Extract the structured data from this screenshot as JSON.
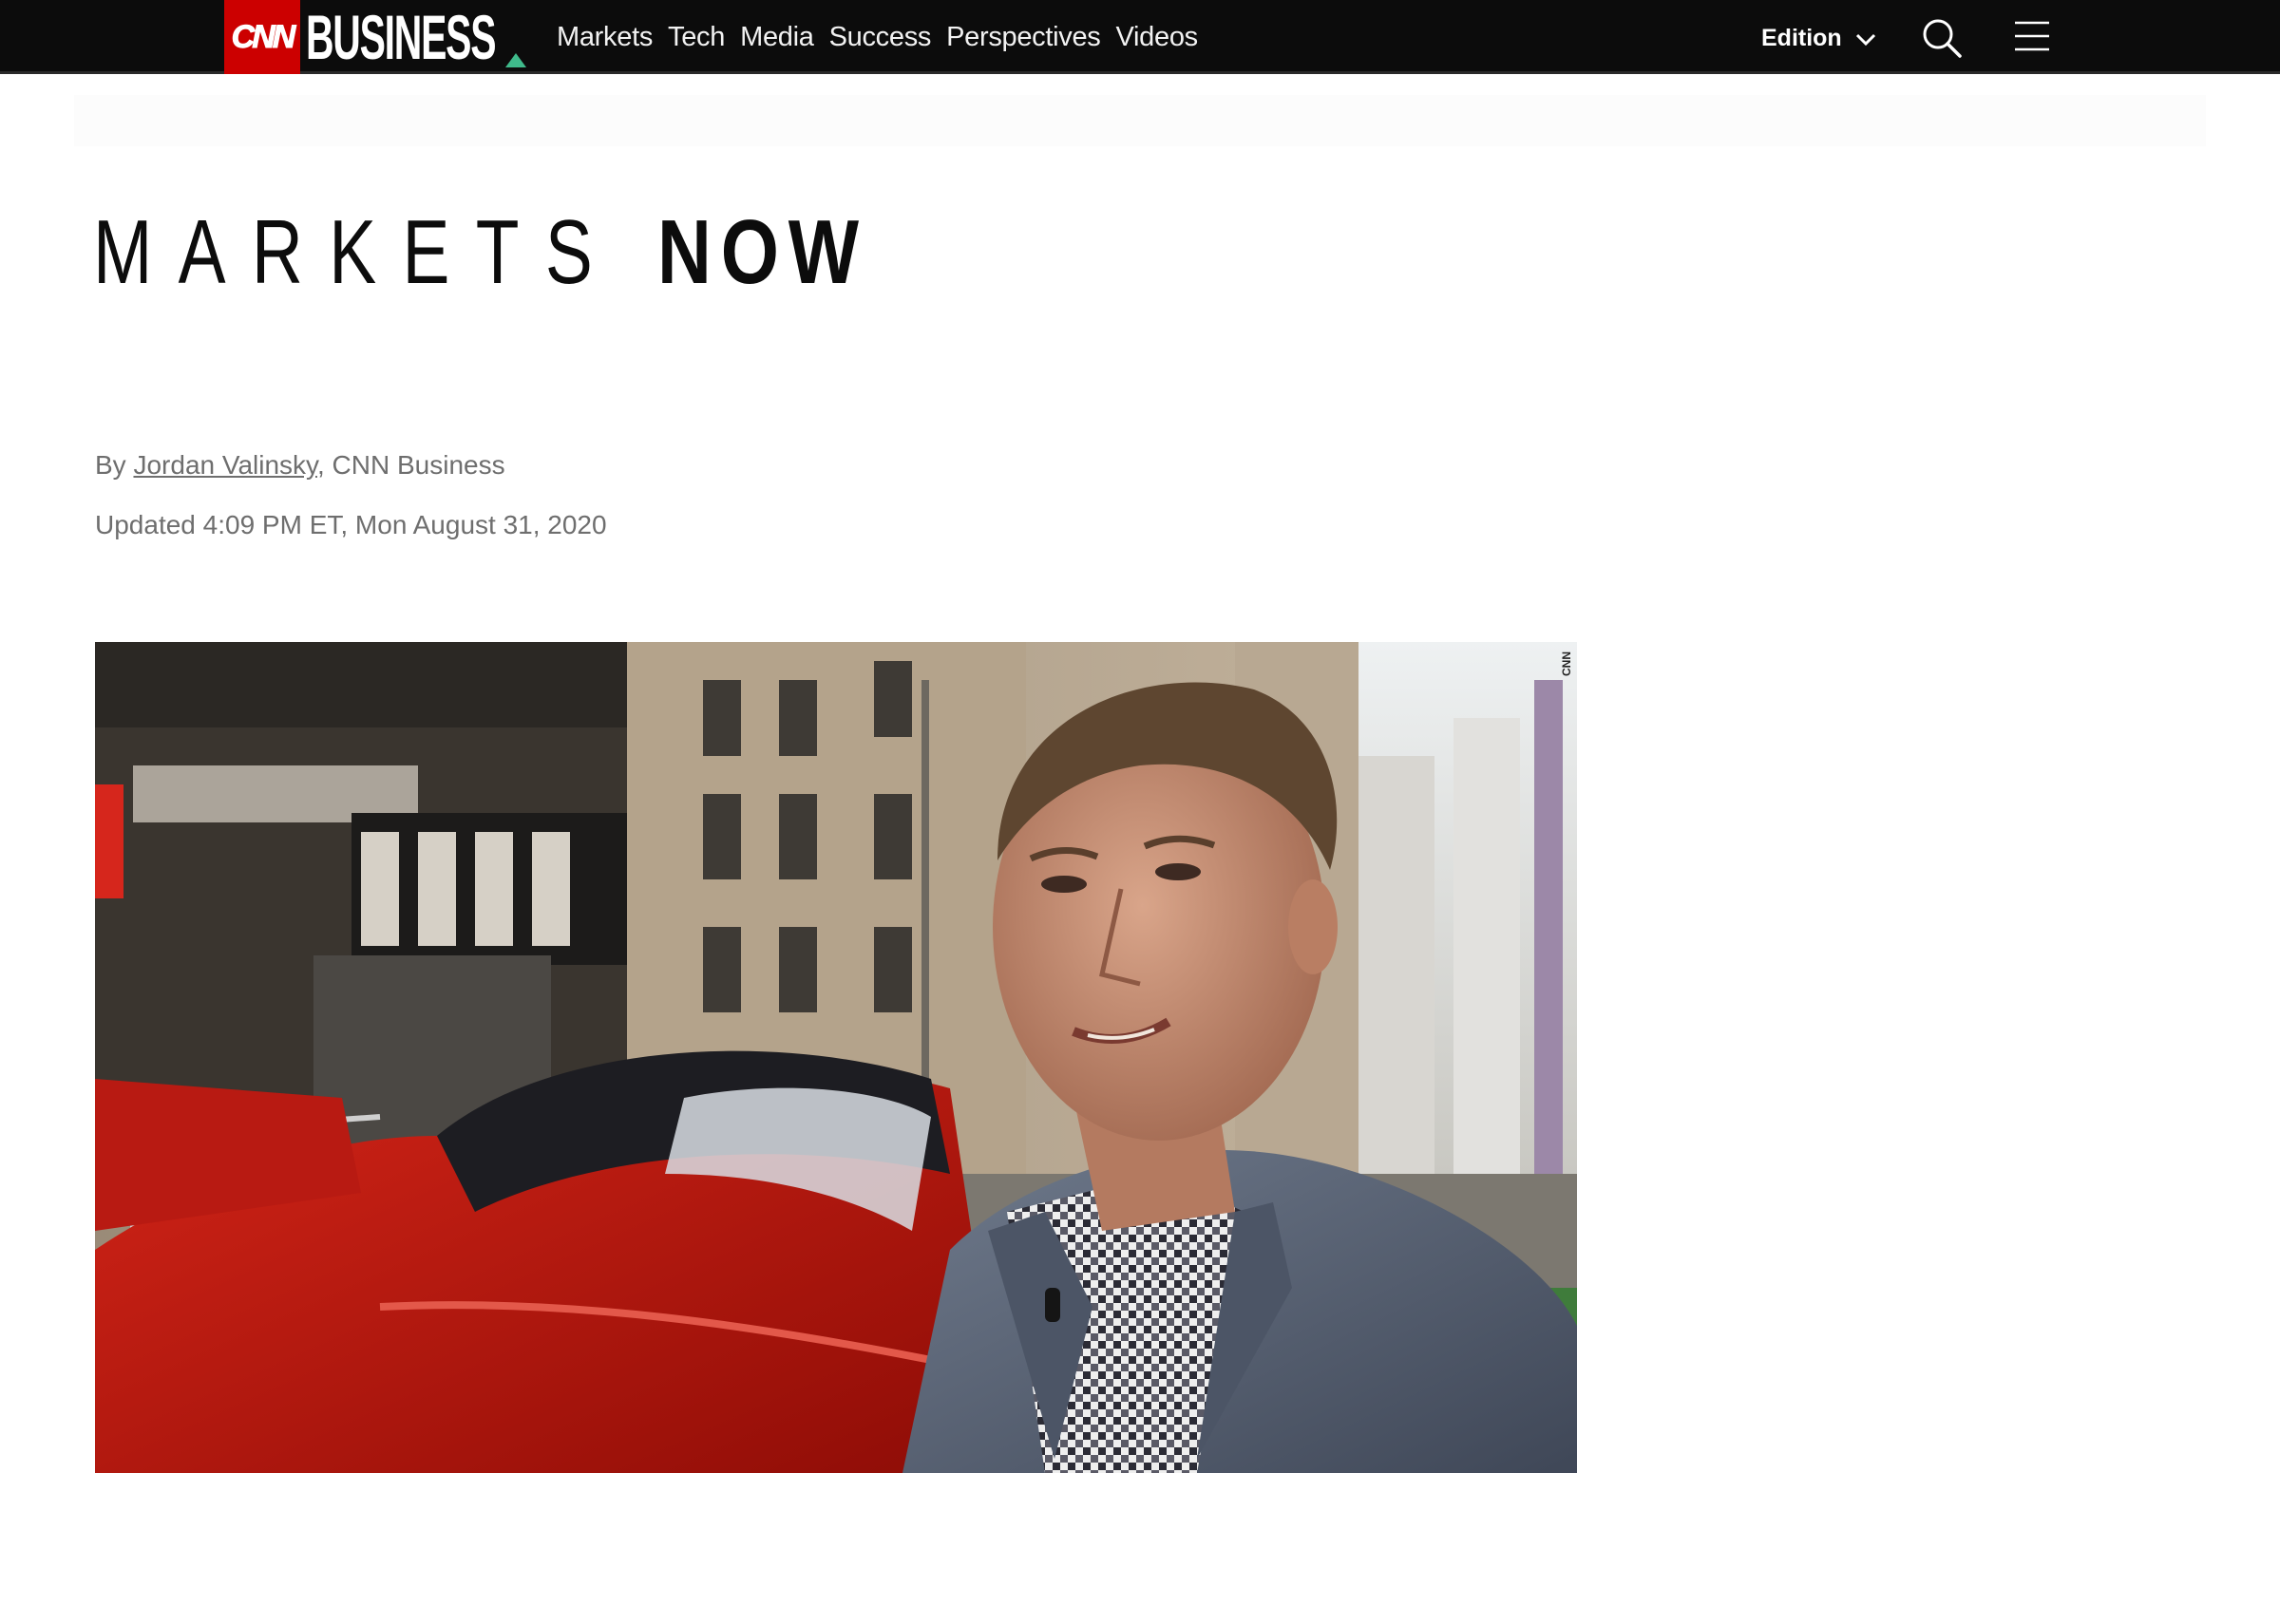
{
  "header": {
    "brand_cnn": "CNN",
    "brand_business": "BUSINESS",
    "nav": [
      {
        "label": "Markets"
      },
      {
        "label": "Tech"
      },
      {
        "label": "Media"
      },
      {
        "label": "Success"
      },
      {
        "label": "Perspectives"
      },
      {
        "label": "Videos"
      }
    ],
    "edition_label": "Edition",
    "icons": {
      "search": "search-icon",
      "menu": "hamburger-menu-icon",
      "edition": "chevron-down-icon"
    },
    "colors": {
      "bar": "#0c0c0c",
      "brand_red": "#cc0000",
      "brand_triangle": "#3fba8b"
    }
  },
  "section": {
    "logo_light": "MARKETS",
    "logo_bold": "NOW"
  },
  "article": {
    "byline_prefix": "By ",
    "author": "Jordan Valinsky",
    "byline_suffix": ", CNN Business",
    "updated": "Updated 4:09 PM ET, Mon August 31, 2020"
  },
  "hero": {
    "watermark": "CNN"
  }
}
